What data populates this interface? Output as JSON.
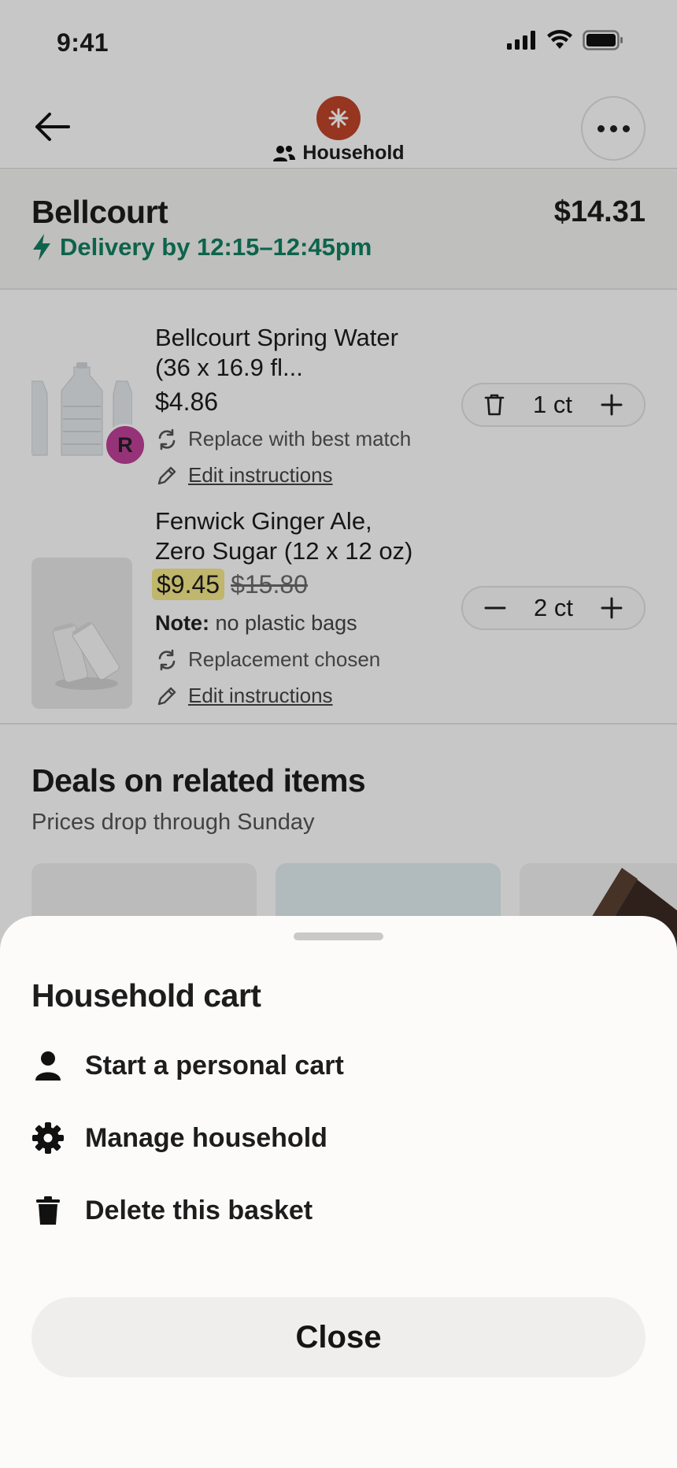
{
  "status_bar": {
    "time": "9:41"
  },
  "nav": {
    "household_label": "Household"
  },
  "store": {
    "name": "Bellcourt",
    "total": "$14.31",
    "delivery": "Delivery by 12:15–12:45pm"
  },
  "items": [
    {
      "title_line1": "Bellcourt Spring Water",
      "title_line2": "(36 x 16.9 fl...",
      "price": "$4.86",
      "replacement": "Replace with best match",
      "edit": "Edit instructions",
      "quantity": "1 ct",
      "avatar_initial": "R"
    },
    {
      "title_line1": "Fenwick Ginger Ale,",
      "title_line2": "Zero Sugar (12 x 12 oz)",
      "price_sale": "$9.45",
      "price_old": "$15.80",
      "note_label": "Note:",
      "note_text": " no plastic bags",
      "replacement": "Replacement chosen",
      "edit": "Edit instructions",
      "quantity": "2 ct"
    }
  ],
  "deals": {
    "title": "Deals on related items",
    "subtitle": "Prices drop through Sunday"
  },
  "sheet": {
    "title": "Household cart",
    "menu": [
      {
        "label": "Start a personal cart",
        "icon": "person-icon"
      },
      {
        "label": "Manage household",
        "icon": "gear-icon"
      },
      {
        "label": "Delete this basket",
        "icon": "trash-icon"
      }
    ],
    "close_label": "Close"
  },
  "colors": {
    "accent_green": "#108060",
    "store_brand": "#c0452a",
    "sale_highlight": "#f7e98b",
    "avatar": "#c0409a"
  }
}
